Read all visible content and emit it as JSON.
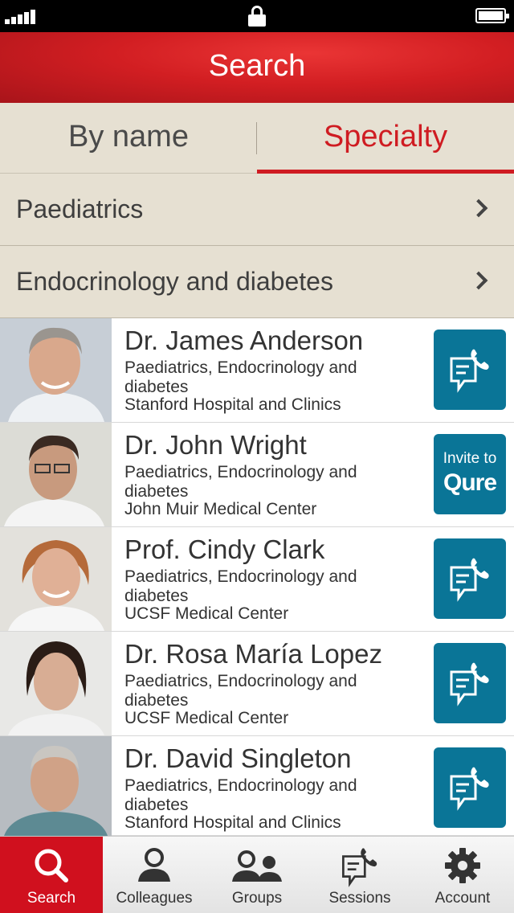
{
  "header": {
    "title": "Search"
  },
  "tabs": {
    "by_name": "By name",
    "specialty": "Specialty",
    "selected": "Specialty"
  },
  "specialties": [
    {
      "label": "Paediatrics"
    },
    {
      "label": "Endocrinology and diabetes"
    }
  ],
  "doctors": [
    {
      "name": "Dr. James Anderson",
      "specialty": "Paediatrics, Endocrinology and diabetes",
      "place": "Stanford Hospital and Clinics",
      "action": "session-icon"
    },
    {
      "name": "Dr. John Wright",
      "specialty": "Paediatrics, Endocrinology and diabetes",
      "place": "John Muir Medical Center",
      "action": "invite",
      "invite_line1": "Invite to",
      "invite_line2": "Qure"
    },
    {
      "name": "Prof. Cindy Clark",
      "specialty": "Paediatrics, Endocrinology and diabetes",
      "place": "UCSF Medical Center",
      "action": "session-icon"
    },
    {
      "name": "Dr. Rosa María Lopez",
      "specialty": "Paediatrics, Endocrinology and diabetes",
      "place": "UCSF Medical Center",
      "action": "session-icon"
    },
    {
      "name": "Dr. David Singleton",
      "specialty": "Paediatrics, Endocrinology and diabetes",
      "place": "Stanford Hospital and Clinics",
      "action": "session-icon"
    }
  ],
  "tabbar": [
    {
      "label": "Search",
      "icon": "search-icon",
      "active": true
    },
    {
      "label": "Colleagues",
      "icon": "person-icon"
    },
    {
      "label": "Groups",
      "icon": "group-icon"
    },
    {
      "label": "Sessions",
      "icon": "session-icon"
    },
    {
      "label": "Account",
      "icon": "gear-icon"
    }
  ],
  "colors": {
    "brand_red": "#d21e22",
    "action_teal": "#0a7597",
    "panel_beige": "#e6e0d2"
  }
}
